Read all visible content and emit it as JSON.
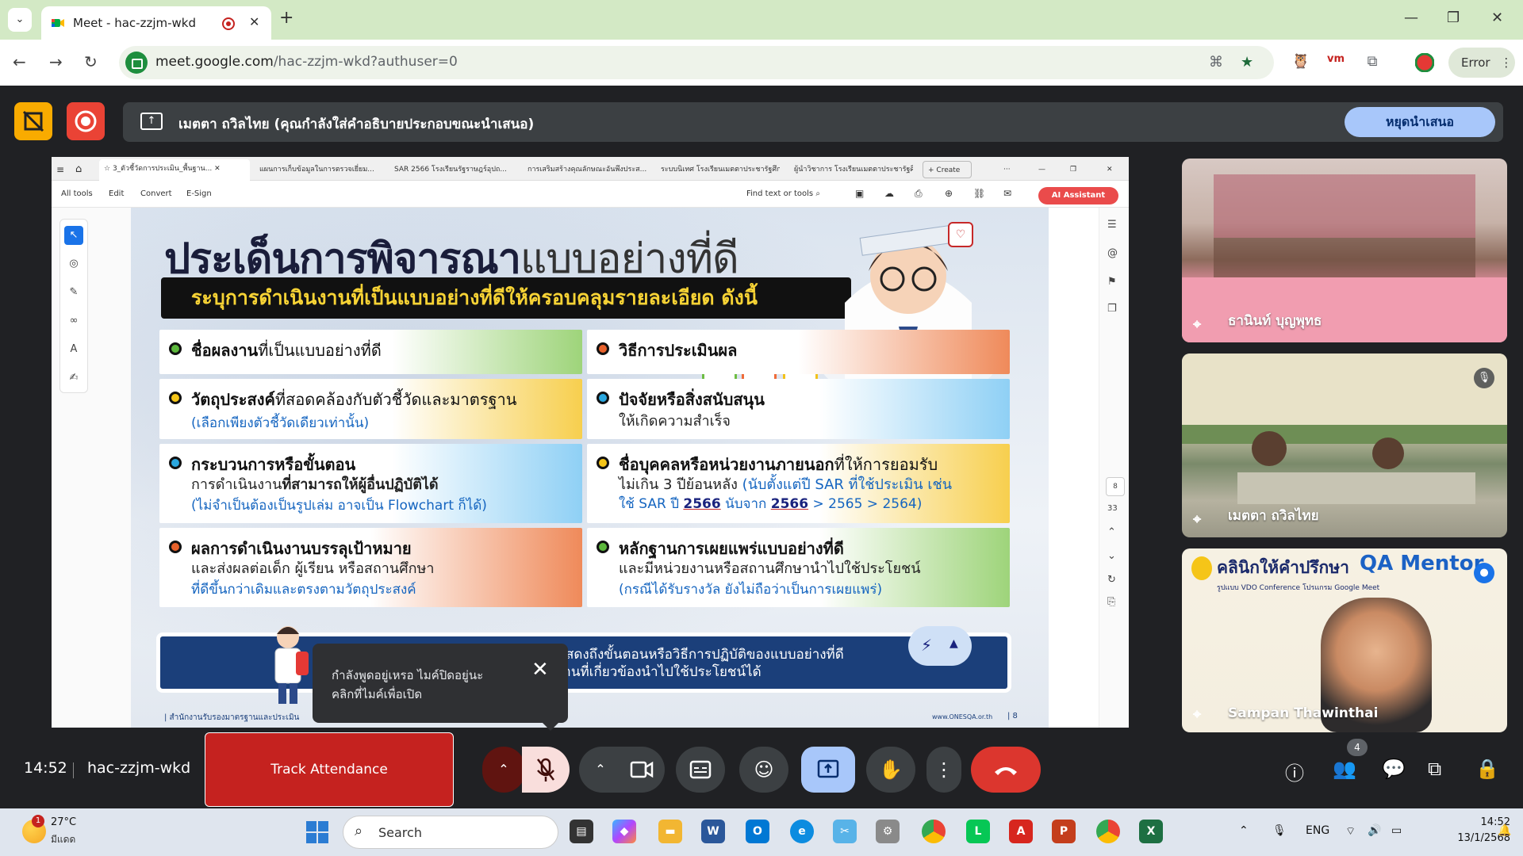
{
  "browser": {
    "tab_title": "Meet - hac-zzjm-wkd",
    "url_host": "meet.google.com",
    "url_path": "/hac-zzjm-wkd?authuser=0",
    "profile_label": "Error"
  },
  "meet": {
    "presenting_banner": "เมตตา ถวิลไทย (คุณกำลังใส่คำอธิบายประกอบขณะนำเสนอ)",
    "stop_presenting": "หยุดนำเสนอ",
    "time": "14:52",
    "meeting_code": "hac-zzjm-wkd",
    "track_attendance": "Track Attendance",
    "people_count": "4",
    "mic_tooltip": {
      "line1": "กำลังพูดอยู่เหรอ ไมค์ปิดอยู่นะ",
      "line2": "คลิกที่ไมค์เพื่อเปิด"
    },
    "participants": [
      {
        "name": "ธานินท์ บุญพุทธ"
      },
      {
        "name": "เมตตา ถวิลไทย"
      },
      {
        "name": "Sampan Thawinthai"
      }
    ],
    "qa_tile": {
      "title": "คลินิกให้คำปรึกษา",
      "brand": "QA Mentor",
      "subtitle": "รูปแบบ VDO Conference โปรแกรม Google Meet"
    }
  },
  "acrobat": {
    "tabs": [
      "3_ตัวชี้วัดการประเมิน_พื้นฐาน...",
      "แผนการเก็บข้อมูลในการตรวจเยี่ยม...",
      "SAR 2566 โรงเรียนรัฐราษฎร์อุปถ...",
      "การเสริมสร้างคุณลักษณะอันพึงประส...",
      "ระบบนิเทศ โรงเรียนเมตตาประชารัฐศึกษ...",
      "ผู้นำวิชาการ โรงเรียนเมตตาประชารัฐศึก..."
    ],
    "create_label": "Create",
    "menu": [
      "All tools",
      "Edit",
      "Convert",
      "E-Sign"
    ],
    "find_label": "Find text or tools",
    "ai_label": "AI Assistant",
    "page_current": "8",
    "page_total": "33"
  },
  "slide": {
    "title_bold": "ประเด็นการพิจารณา",
    "title_light": "แบบอย่างที่ดี",
    "subtitle": "ระบุการดำเนินงานที่เป็นแบบอย่างที่ดีให้ครอบคลุมรายละเอียด ดังนี้",
    "items": {
      "work_name": {
        "bold": "ชื่อผลงาน",
        "rest": "ที่เป็นแบบอย่างที่ดี"
      },
      "objective": {
        "bold": "วัตถุประสงค์",
        "rest": "ที่สอดคล้องกับตัวชี้วัดและมาตรฐาน",
        "note": "(เลือกเพียงตัวชี้วัดเดียวเท่านั้น)"
      },
      "process": {
        "bold": "กระบวนการหรือขั้นตอน",
        "line2a": "การดำเนินงาน",
        "line2b": "ที่สามารถให้ผู้อื่นปฏิบัติได้",
        "note": "(ไม่จำเป็นต้องเป็นรูปเล่ม อาจเป็น Flowchart ก็ได้)"
      },
      "result": {
        "bold": "ผลการดำเนินงานบรรลุเป้าหมาย",
        "line2": "และส่งผลต่อเด็ก ผู้เรียน หรือสถานศึกษา",
        "note": "ที่ดีขึ้นกว่าเดิมและตรงตามวัตถุประสงค์"
      },
      "evaluation": {
        "bold": "วิธีการประเมินผล"
      },
      "support": {
        "bold": "ปัจจัยหรือสิ่งสนับสนุน",
        "line2": "ให้เกิดความสำเร็จ"
      },
      "external": {
        "bold": "ชื่อบุคคลหรือหน่วยงานภายนอก",
        "rest": "ที่ให้การยอมรับ",
        "line2a": "ไม่เกิน 3 ปีย้อนหลัง ",
        "line2b": "(นับตั้งแต่ปี SAR ที่ใช้ประเมิน เช่น",
        "line3a": "ใช้ SAR ปี ",
        "year1": "2566",
        "line3b": " นับจาก ",
        "year2": "2566",
        "line3c": " > 2565 > 2564)"
      },
      "evidence": {
        "bold": "หลักฐานการเผยแพร่แบบอย่างที่ดี",
        "line2": "และมีหน่วยงานหรือสถานศึกษานำไปใช้ประโยชน์",
        "note": "(กรณีได้รับรางวัล ยังไม่ถือว่าเป็นการเผยแพร่)"
      }
    },
    "bottom_line1": "แสดงถึงขั้นตอนหรือวิธีการปฏิบัติของแบบอย่างที่ดี",
    "bottom_line2": "งานที่เกี่ยวข้องนำไปใช้ประโยชน์ได้",
    "footer_left": "| สำนักงานรับรองมาตรฐานและประเมิน",
    "footer_right": "www.ONESQA.or.th",
    "footer_page": "| 8"
  },
  "taskbar": {
    "weather_badge": "1",
    "temperature": "27°C",
    "condition": "มีแดด",
    "search_label": "Search",
    "language": "ENG",
    "clock": "14:52",
    "date": "13/1/2568"
  },
  "colors": {
    "meet_bg": "#202124",
    "present_blue": "#a8c7fa",
    "hangup_red": "#dc362e",
    "track_red": "#c5221f",
    "slide_navy": "#1b3f7a",
    "subtitle_yellow": "#f7d335"
  }
}
